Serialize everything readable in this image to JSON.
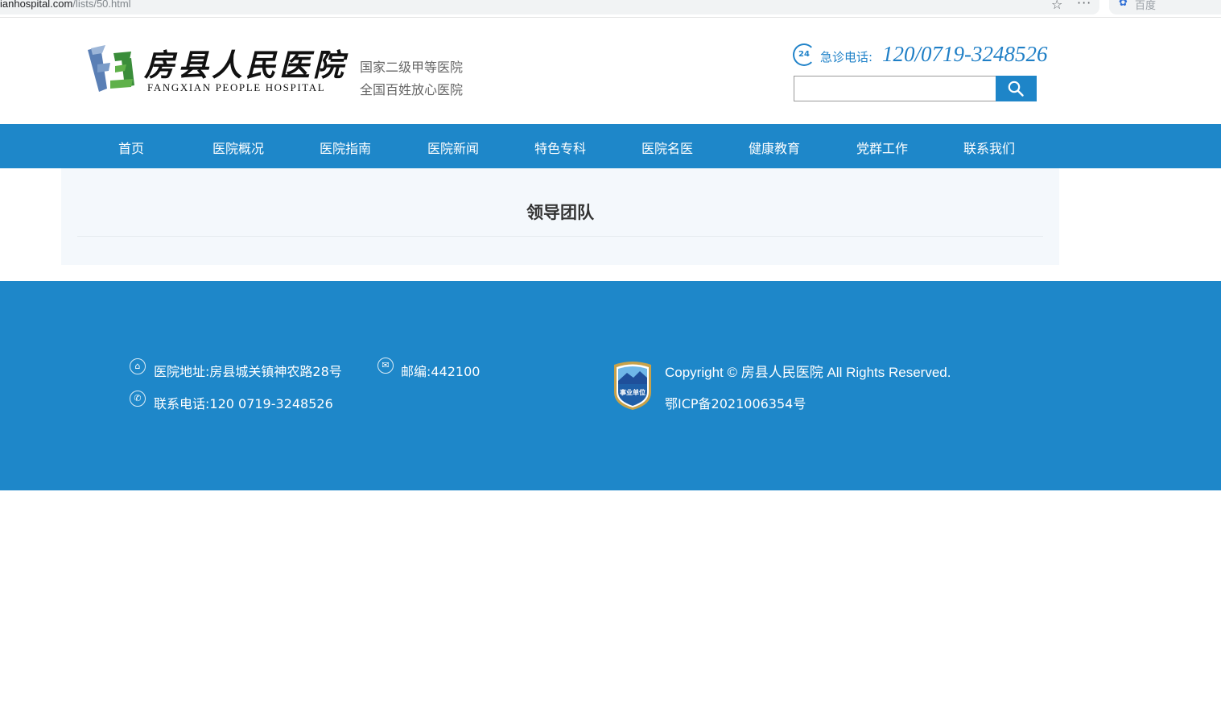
{
  "browser": {
    "url_host": "ianhospital.com",
    "url_path": "/lists/50.html",
    "bookmark_icon": "star-icon",
    "menu_icon": "more-icon",
    "sidebar_tab_label": "百度"
  },
  "header": {
    "logo_cn": "房县人民医院",
    "logo_en": "FANGXIAN PEOPLE HOSPITAL",
    "slogan_line1": "国家二级甲等医院",
    "slogan_line2": "全国百姓放心医院",
    "hotline_icon_text": "24",
    "hotline_label": "急诊电话:",
    "hotline_number": "120/0719-3248526",
    "search_placeholder": "",
    "search_icon": "search-icon"
  },
  "nav": {
    "items": [
      {
        "label": "首页"
      },
      {
        "label": "医院概况"
      },
      {
        "label": "医院指南"
      },
      {
        "label": "医院新闻"
      },
      {
        "label": "特色专科"
      },
      {
        "label": "医院名医"
      },
      {
        "label": "健康教育"
      },
      {
        "label": "党群工作"
      },
      {
        "label": "联系我们"
      }
    ]
  },
  "main": {
    "title": "领导团队"
  },
  "footer": {
    "address": "医院地址:房县城关镇神农路28号",
    "postcode": "邮编:442100",
    "phone": "联系电话:120 0719-3248526",
    "copyright": "Copyright © 房县人民医院 All Rights Reserved.",
    "icp": "鄂ICP备2021006354号",
    "badge_text": "事业单位",
    "colors": {
      "primary": "#1e87c9",
      "content_bg": "#f4f8fc"
    }
  }
}
